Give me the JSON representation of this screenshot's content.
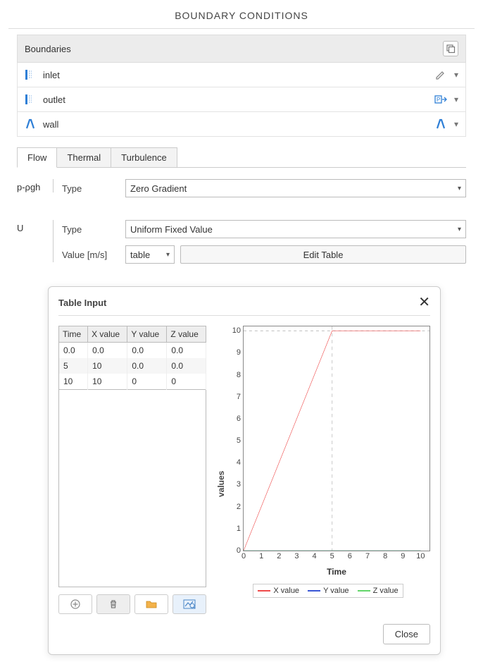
{
  "title": "BOUNDARY CONDITIONS",
  "boundaries": {
    "header": "Boundaries",
    "items": [
      {
        "name": "inlet"
      },
      {
        "name": "outlet"
      },
      {
        "name": "wall"
      }
    ]
  },
  "tabs": [
    "Flow",
    "Thermal",
    "Turbulence"
  ],
  "active_tab": 0,
  "p_rgh": {
    "label": "p-ρgh",
    "type_label": "Type",
    "type_value": "Zero Gradient"
  },
  "U": {
    "label": "U",
    "type_label": "Type",
    "type_value": "Uniform Fixed Value",
    "value_label": "Value [m/s]",
    "value_mode": "table",
    "edit_btn": "Edit Table"
  },
  "dialog": {
    "title": "Table Input",
    "table": {
      "headers": [
        "Time",
        "X value",
        "Y value",
        "Z value"
      ],
      "rows": [
        [
          "0.0",
          "0.0",
          "0.0",
          "0.0"
        ],
        [
          "5",
          "10",
          "0.0",
          "0.0"
        ],
        [
          "10",
          "10",
          "0",
          "0"
        ]
      ]
    },
    "close_label": "Close"
  },
  "chart_data": {
    "type": "line",
    "title": "",
    "xlabel": "Time",
    "ylabel": "values",
    "xlim": [
      0,
      10.5
    ],
    "ylim": [
      0,
      10.2
    ],
    "xticks": [
      0,
      1,
      2,
      3,
      4,
      5,
      6,
      7,
      8,
      9,
      10
    ],
    "yticks": [
      0,
      1,
      2,
      3,
      4,
      5,
      6,
      7,
      8,
      9,
      10
    ],
    "x": [
      0,
      5,
      10
    ],
    "series": [
      {
        "name": "X value",
        "color": "#ef4b4b",
        "values": [
          0,
          10,
          10
        ]
      },
      {
        "name": "Y value",
        "color": "#3a57d6",
        "values": [
          0,
          0,
          0
        ]
      },
      {
        "name": "Z value",
        "color": "#63d66a",
        "values": [
          0,
          0,
          0
        ]
      }
    ],
    "legend_position": "bottom"
  }
}
